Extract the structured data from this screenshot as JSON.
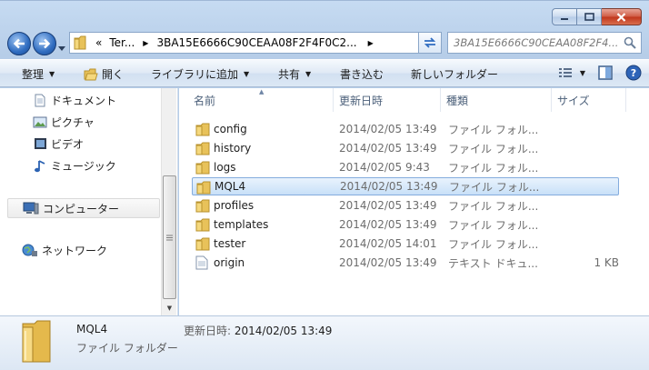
{
  "window": {
    "caption": {
      "minimize_icon": "minimize-icon",
      "maximize_icon": "maximize-icon",
      "close_icon": "close-icon"
    }
  },
  "address_bar": {
    "overflow": "«",
    "segments": [
      "Ter...",
      "3BA15E6666C90CEAA08F2F4F0C2..."
    ],
    "search_placeholder": "3BA15E6666C90CEAA08F2F4..."
  },
  "toolbar": {
    "organize": "整理",
    "open": "開く",
    "include_in_library": "ライブラリに追加",
    "share": "共有",
    "burn": "書き込む",
    "new_folder": "新しいフォルダー"
  },
  "nav_pane": {
    "documents": "ドキュメント",
    "pictures": "ピクチャ",
    "videos": "ビデオ",
    "music": "ミュージック",
    "computer": "コンピューター",
    "network": "ネットワーク"
  },
  "columns": {
    "name": "名前",
    "date": "更新日時",
    "type": "種類",
    "size": "サイズ"
  },
  "files": [
    {
      "name": "config",
      "date": "2014/02/05 13:49",
      "type": "ファイル フォル...",
      "size": "",
      "kind": "folder"
    },
    {
      "name": "history",
      "date": "2014/02/05 13:49",
      "type": "ファイル フォル...",
      "size": "",
      "kind": "folder"
    },
    {
      "name": "logs",
      "date": "2014/02/05 9:43",
      "type": "ファイル フォル...",
      "size": "",
      "kind": "folder"
    },
    {
      "name": "MQL4",
      "date": "2014/02/05 13:49",
      "type": "ファイル フォル...",
      "size": "",
      "kind": "folder"
    },
    {
      "name": "profiles",
      "date": "2014/02/05 13:49",
      "type": "ファイル フォル...",
      "size": "",
      "kind": "folder"
    },
    {
      "name": "templates",
      "date": "2014/02/05 13:49",
      "type": "ファイル フォル...",
      "size": "",
      "kind": "folder"
    },
    {
      "name": "tester",
      "date": "2014/02/05 14:01",
      "type": "ファイル フォル...",
      "size": "",
      "kind": "folder"
    },
    {
      "name": "origin",
      "date": "2014/02/05 13:49",
      "type": "テキスト ドキュ...",
      "size": "1 KB",
      "kind": "text"
    }
  ],
  "details": {
    "name": "MQL4",
    "type": "ファイル フォルダー",
    "modified_label": "更新日時:",
    "modified_value": "2014/02/05 13:49"
  },
  "colors": {
    "folder": "#e8c25a",
    "selection": "#cce4f7",
    "accent": "#2f6cc0"
  }
}
